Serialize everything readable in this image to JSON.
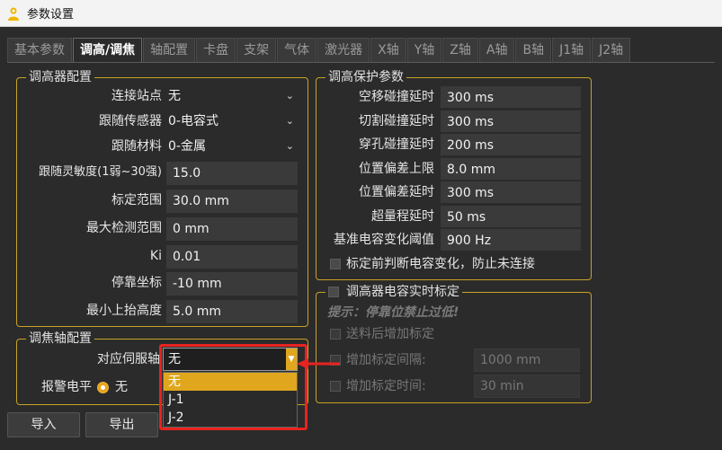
{
  "window": {
    "title": "参数设置"
  },
  "tabs": [
    {
      "label": "基本参数",
      "active": false
    },
    {
      "label": "调高/调焦",
      "active": true
    },
    {
      "label": "轴配置",
      "active": false
    },
    {
      "label": "卡盘",
      "active": false
    },
    {
      "label": "支架",
      "active": false
    },
    {
      "label": "气体",
      "active": false
    },
    {
      "label": "激光器",
      "active": false
    },
    {
      "label": "X轴",
      "active": false
    },
    {
      "label": "Y轴",
      "active": false
    },
    {
      "label": "Z轴",
      "active": false
    },
    {
      "label": "A轴",
      "active": false
    },
    {
      "label": "B轴",
      "active": false
    },
    {
      "label": "J1轴",
      "active": false
    },
    {
      "label": "J2轴",
      "active": false
    }
  ],
  "height_config": {
    "title": "调高器配置",
    "station": {
      "label": "连接站点",
      "value": "无"
    },
    "sensor": {
      "label": "跟随传感器",
      "value": "0-电容式"
    },
    "material": {
      "label": "跟随材料",
      "value": "0-金属"
    },
    "sensitivity": {
      "label": "跟随灵敏度(1弱~30强)",
      "value": "15.0"
    },
    "calib_range": {
      "label": "标定范围",
      "value": "30.0 mm"
    },
    "max_detect": {
      "label": "最大检测范围",
      "value": "0 mm"
    },
    "ki": {
      "label": "Ki",
      "value": "0.01"
    },
    "park_coord": {
      "label": "停靠坐标",
      "value": "-10 mm"
    },
    "min_lift": {
      "label": "最小上抬高度",
      "value": "5.0 mm"
    }
  },
  "focus_config": {
    "title": "调焦轴配置",
    "servo_label": "对应伺服轴",
    "servo_value": "无",
    "alarm_label": "报警电平",
    "alarm_value": "无",
    "options": [
      "无",
      "J-1",
      "J-2"
    ]
  },
  "protect": {
    "title": "调高保护参数",
    "rows": [
      {
        "label": "空移碰撞延时",
        "value": "300 ms"
      },
      {
        "label": "切割碰撞延时",
        "value": "300 ms"
      },
      {
        "label": "穿孔碰撞延时",
        "value": "200 ms"
      },
      {
        "label": "位置偏差上限",
        "value": "8.0 mm"
      },
      {
        "label": "位置偏差延时",
        "value": "300 ms"
      },
      {
        "label": "超量程延时",
        "value": "50 ms"
      },
      {
        "label": "基准电容变化阈值",
        "value": "900 Hz"
      }
    ],
    "check_label": "标定前判断电容变化，防止未连接"
  },
  "realtime": {
    "title": "调高器电容实时标定",
    "hint": "提示：停靠位禁止过低!",
    "add_after_feed": "送料后增加标定",
    "interval_label": "增加标定间隔:",
    "interval_value": "1000 mm",
    "time_label": "增加标定时间:",
    "time_value": "30 min"
  },
  "buttons": {
    "import": "导入",
    "export": "导出"
  },
  "colors": {
    "accent": "#e0a61d",
    "group_border": "#c9a227",
    "highlight": "#e8231f",
    "background": "#2b2b2b"
  }
}
